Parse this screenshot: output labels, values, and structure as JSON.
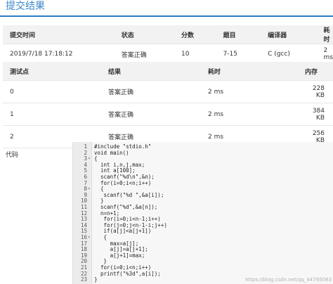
{
  "page": {
    "title": "提交结果"
  },
  "summary": {
    "headers": [
      "提交时间",
      "状态",
      "分数",
      "题目",
      "编译器",
      "耗时"
    ],
    "row": {
      "time": "2019/7/18 17:18:12",
      "status": "答案正确",
      "score": "10",
      "problem": "7-15",
      "compiler": "C (gcc)",
      "elapsed": "2 ms"
    }
  },
  "tests": {
    "headers": [
      "测试点",
      "结果",
      "耗时",
      "内存"
    ],
    "rows": [
      {
        "id": "0",
        "result": "答案正确",
        "time": "2 ms",
        "memory": "228 KB"
      },
      {
        "id": "1",
        "result": "答案正确",
        "time": "2 ms",
        "memory": "384 KB"
      },
      {
        "id": "2",
        "result": "答案正确",
        "time": "2 ms",
        "memory": "256 KB"
      }
    ]
  },
  "code": {
    "label": "代码",
    "lines": [
      "#include \"stdio.h\"",
      "void main()",
      "{",
      "  int i,n,j,max;",
      "  int a[100];",
      "  scanf(\"%d\\n\",&n);",
      "  for(i=0;i<n;i++)",
      "  {",
      "   scanf(\"%d \",&a[i]);",
      "  }",
      "  scanf(\"%d\",&a[n]);",
      "  n=n+1;",
      "   for(i=0;i<n-1;i++)",
      "   for(j=0;j<n-1-i;j++)",
      "   if(a[j]<a[j+1])",
      "   {",
      "     max=a[j];",
      "     a[j]=a[j+1];",
      "     a[j+1]=max;",
      "   }",
      "  for(i=0;i<n;i++)",
      "  printf(\"%3d\",a[i]);",
      "}"
    ],
    "fold_lines": [
      3,
      8,
      16
    ]
  },
  "watermark": "https://blog.csdn.net/qq_44795063"
}
